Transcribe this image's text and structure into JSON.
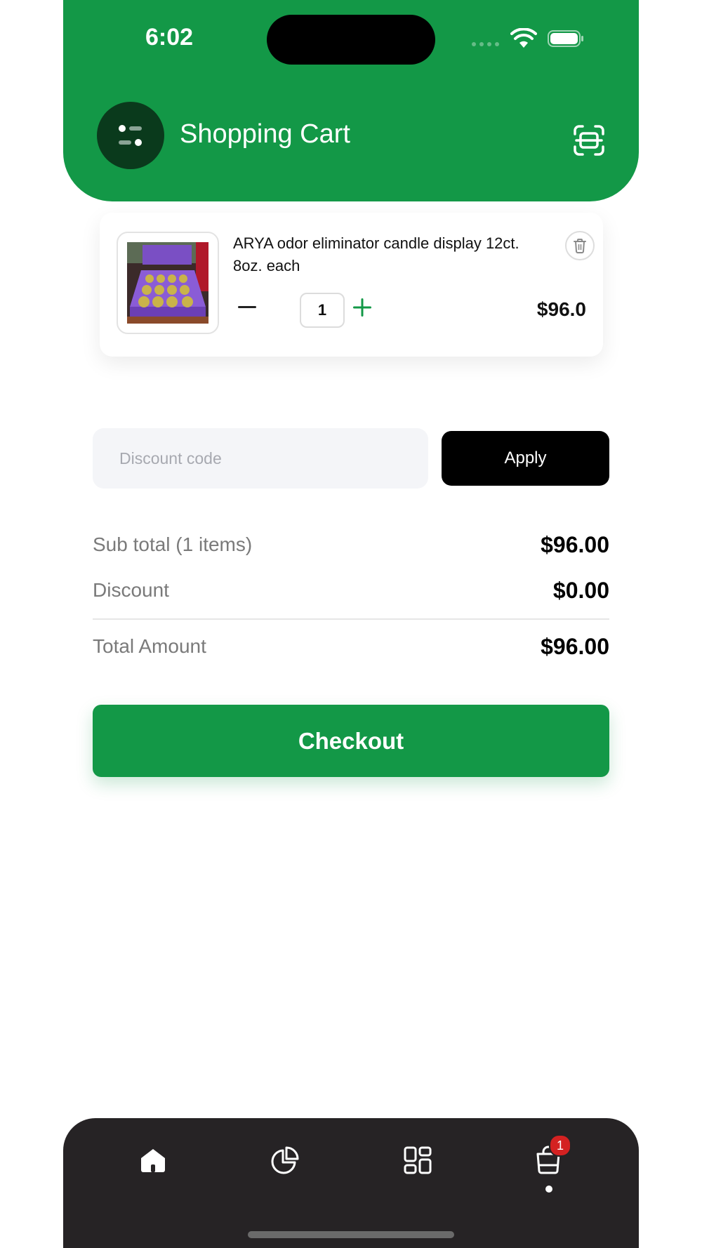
{
  "status_bar": {
    "time": "6:02"
  },
  "header": {
    "title": "Shopping Cart",
    "menu_icon": "menu-dots-icon",
    "scan_icon": "scan-icon"
  },
  "cart": {
    "items": [
      {
        "name": "ARYA odor eliminator candle display 12ct. 8oz. each",
        "quantity": "1",
        "price": "$96.0"
      }
    ]
  },
  "discount": {
    "placeholder": "Discount code",
    "value": "",
    "apply_label": "Apply"
  },
  "summary": {
    "subtotal_label": "Sub total (1 items)",
    "subtotal_value": "$96.00",
    "discount_label": "Discount",
    "discount_value": "$0.00",
    "total_label": "Total Amount",
    "total_value": "$96.00"
  },
  "checkout_label": "Checkout",
  "tabbar": {
    "tabs": [
      {
        "icon": "home-icon"
      },
      {
        "icon": "pie-chart-icon"
      },
      {
        "icon": "grid-icon"
      },
      {
        "icon": "cart-icon",
        "active": true
      }
    ],
    "cart_badge": "1"
  },
  "colors": {
    "brand": "#139847",
    "dark": "#0a3a1c",
    "tabbar": "#262325",
    "badge": "#d42121"
  }
}
